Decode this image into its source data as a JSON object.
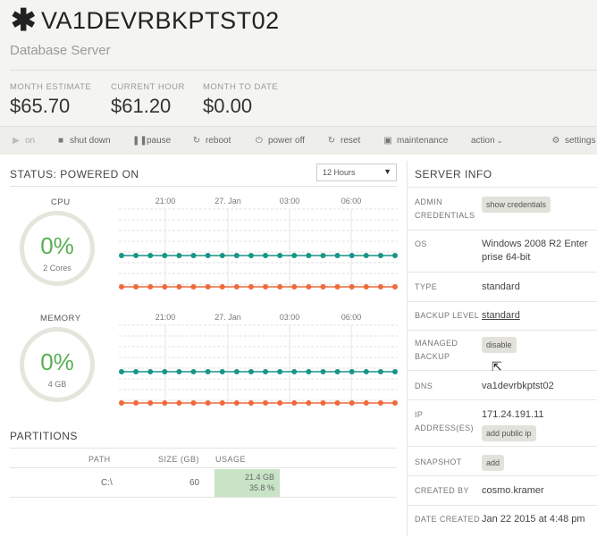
{
  "server": {
    "icon": "asterisk-icon",
    "name": "VA1DEVRBKPTST02",
    "type": "Database Server"
  },
  "stats": [
    {
      "label": "MONTH ESTIMATE",
      "value": "$65.70"
    },
    {
      "label": "CURRENT HOUR",
      "value": "$61.20"
    },
    {
      "label": "MONTH TO DATE",
      "value": "$0.00"
    }
  ],
  "toolbar": {
    "on": {
      "label": "on",
      "icon": "play-icon"
    },
    "shutdown": {
      "label": "shut down",
      "icon": "stop-icon"
    },
    "pause": {
      "label": "pause",
      "icon": "pause-icon"
    },
    "reboot": {
      "label": "reboot",
      "icon": "refresh-icon"
    },
    "poweroff": {
      "label": "power off",
      "icon": "power-icon"
    },
    "reset": {
      "label": "reset",
      "icon": "refresh-icon"
    },
    "maintenance": {
      "label": "maintenance",
      "icon": "briefcase-icon"
    },
    "action": {
      "label": "action",
      "icon": "chevron-down-icon"
    },
    "settings": {
      "label": "settings",
      "icon": "gear-icon"
    }
  },
  "status": {
    "title": "STATUS: POWERED ON",
    "range_select": "12 Hours"
  },
  "cpu": {
    "label": "CPU",
    "percent": "0%",
    "sub": "2 Cores"
  },
  "memory": {
    "label": "MEMORY",
    "percent": "0%",
    "sub": "4 GB"
  },
  "chart_data": [
    {
      "type": "line",
      "x_ticks": [
        "21:00",
        "27. Jan",
        "03:00",
        "06:00"
      ],
      "series": [
        {
          "color": "#1a9488",
          "values": [
            0,
            0,
            0,
            0,
            0,
            0,
            0,
            0,
            0,
            0,
            0,
            0,
            0,
            0,
            0,
            0,
            0,
            0,
            0,
            0
          ]
        },
        {
          "color": "#ee6a3c",
          "values": [
            0,
            0,
            0,
            0,
            0,
            0,
            0,
            0,
            0,
            0,
            0,
            0,
            0,
            0,
            0,
            0,
            0,
            0,
            0,
            0
          ]
        }
      ]
    },
    {
      "type": "line",
      "x_ticks": [
        "21:00",
        "27. Jan",
        "03:00",
        "06:00"
      ],
      "series": [
        {
          "color": "#1a9488",
          "values": [
            0,
            0,
            0,
            0,
            0,
            0,
            0,
            0,
            0,
            0,
            0,
            0,
            0,
            0,
            0,
            0,
            0,
            0,
            0,
            0
          ]
        },
        {
          "color": "#ee6a3c",
          "values": [
            0,
            0,
            0,
            0,
            0,
            0,
            0,
            0,
            0,
            0,
            0,
            0,
            0,
            0,
            0,
            0,
            0,
            0,
            0,
            0
          ]
        }
      ]
    }
  ],
  "partitions": {
    "title": "PARTITIONS",
    "headers": {
      "path": "PATH",
      "size": "SIZE (GB)",
      "usage": "USAGE"
    },
    "rows": [
      {
        "path": "C:\\",
        "size": "60",
        "usage_gb": "21.4 GB",
        "usage_pct": "35.8 %"
      }
    ]
  },
  "server_info": {
    "title": "SERVER INFO",
    "admin_credentials": {
      "label_1": "ADMIN",
      "label_2": "CREDENTIALS",
      "button": "show credentials"
    },
    "os": {
      "label": "OS",
      "value_1": "Windows 2008 R2 Enter",
      "value_2": "prise 64-bit"
    },
    "type": {
      "label": "TYPE",
      "value": "standard"
    },
    "backup_level": {
      "label": "BACKUP LEVEL",
      "value": "standard"
    },
    "managed_backup": {
      "label_1": "MANAGED",
      "label_2": "BACKUP",
      "button": "disable"
    },
    "dns": {
      "label": "DNS",
      "value": "va1devrbkptst02"
    },
    "ip": {
      "label_1": "IP",
      "label_2": "ADDRESS(ES)",
      "value": "171.24.191.11",
      "button": "add public ip"
    },
    "snapshot": {
      "label": "SNAPSHOT",
      "button": "add"
    },
    "created_by": {
      "label": "CREATED BY",
      "value": "cosmo.kramer"
    },
    "date_created": {
      "label": "DATE CREATED",
      "value": "Jan 22 2015 at 4:48 pm"
    }
  },
  "colors": {
    "accent_green": "#58b053",
    "teal": "#1a9488",
    "orange": "#ee6a3c"
  }
}
